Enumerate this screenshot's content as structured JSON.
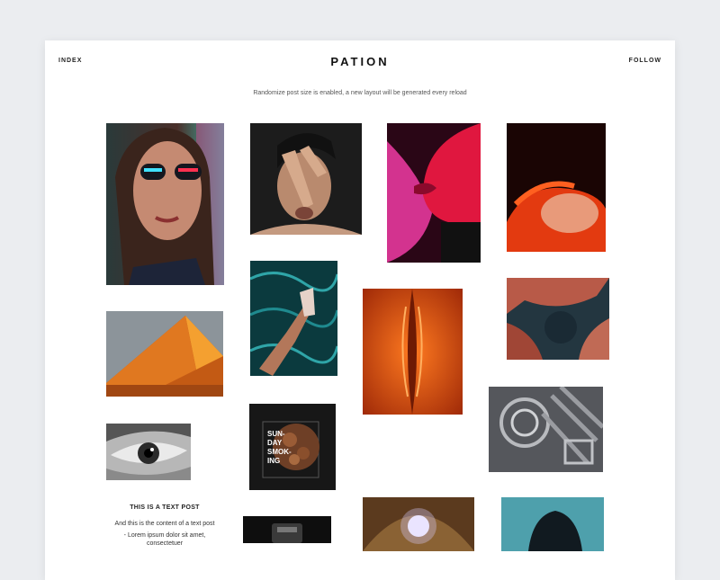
{
  "nav": {
    "index_label": "INDEX",
    "title": "PATION",
    "follow_label": "FOLLOW"
  },
  "notice": "Randomize post size is enabled, a new layout will be generated every reload",
  "text_post": {
    "title": "THIS IS A TEXT POST",
    "lines": [
      "And this is the content of a text post",
      "- Lorem ipsum dolor sit amet, consectetuer"
    ]
  },
  "overlay_text": {
    "line1": "SUN-",
    "line2": "DAY",
    "line3": "SMOK-",
    "line4": "ING"
  },
  "colors": {
    "background": "#ebedf0",
    "page": "#ffffff",
    "text": "#222222"
  }
}
